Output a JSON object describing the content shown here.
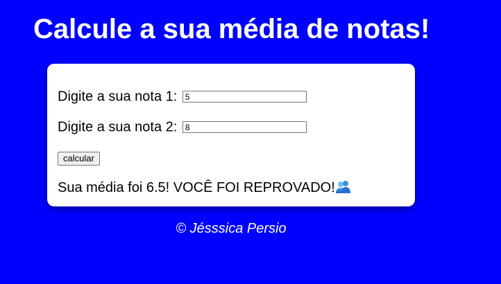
{
  "header": {
    "title": "Calcule a sua média de notas!"
  },
  "form": {
    "nota1_label": "Digite a sua nota 1:",
    "nota1_value": "5",
    "nota2_label": "Digite a sua nota 2:",
    "nota2_value": "8",
    "calculate_label": "calcular"
  },
  "result": {
    "text": "Sua média foi 6.5! VOCÊ FOI REPROVADO!",
    "icon": "people-icon"
  },
  "footer": {
    "text": "© Jésssica Persio"
  },
  "colors": {
    "background": "#0000ff",
    "card": "#ffffff",
    "text": "#000000",
    "title": "#ffffff"
  }
}
